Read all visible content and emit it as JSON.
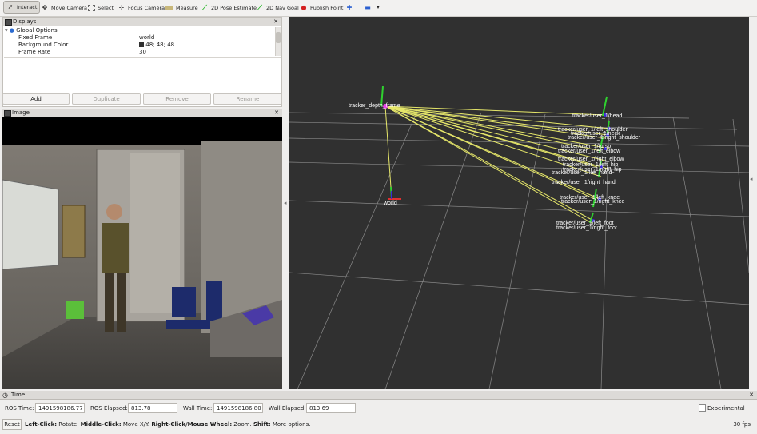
{
  "toolbar": {
    "tools": [
      {
        "label": "Interact",
        "icon": "cursor-icon"
      },
      {
        "label": "Move Camera",
        "icon": "move-icon"
      },
      {
        "label": "Select",
        "icon": "select-icon"
      },
      {
        "label": "Focus Camera",
        "icon": "focus-icon"
      },
      {
        "label": "Measure",
        "icon": "ruler-icon"
      },
      {
        "label": "2D Pose Estimate",
        "icon": "arrow-green-icon"
      },
      {
        "label": "2D Nav Goal",
        "icon": "arrow-green-icon"
      },
      {
        "label": "Publish Point",
        "icon": "pin-icon"
      }
    ]
  },
  "displays": {
    "title": "Displays",
    "global_options": "Global Options",
    "props": [
      {
        "name": "Fixed Frame",
        "value": "world"
      },
      {
        "name": "Background Color",
        "value": "48; 48; 48",
        "swatch": "#303030"
      },
      {
        "name": "Frame Rate",
        "value": "30"
      }
    ],
    "buttons": {
      "add": "Add",
      "duplicate": "Duplicate",
      "remove": "Remove",
      "rename": "Rename"
    }
  },
  "image_panel": {
    "title": "Image"
  },
  "scene": {
    "background": "#303030",
    "frames": {
      "origin": "tracker_depth_frame",
      "world": "world",
      "head": "tracker/user_1/head",
      "labels": [
        "tracker/user_1/left_shoulder",
        "tracker/user_1/neck",
        "tracker/user_1/right_shoulder",
        "tracker/user_1/torso",
        "tracker/user_1/left_elbow",
        "tracker/user_1/right_elbow",
        "tracker/user_1/left_hip",
        "tracker/user_1/right_hip",
        "tracker/user_1/left_hand",
        "tracker/user_1/right_hand",
        "tracker/user_1/left_knee",
        "tracker/user_1/right_knee",
        "tracker/user_1/left_foot",
        "tracker/user_1/right_foot"
      ]
    }
  },
  "time": {
    "title": "Time",
    "ros_time_label": "ROS Time:",
    "ros_time": "1491598186.77",
    "ros_elapsed_label": "ROS Elapsed:",
    "ros_elapsed": "813.78",
    "wall_time_label": "Wall Time:",
    "wall_time": "1491598186.80",
    "wall_elapsed_label": "Wall Elapsed:",
    "wall_elapsed": "813.69",
    "experimental": "Experimental"
  },
  "status": {
    "reset": "Reset",
    "left_click": "Left-Click:",
    "left_click_text": " Rotate. ",
    "middle_click": "Middle-Click:",
    "middle_click_text": " Move X/Y. ",
    "right_click": "Right-Click/Mouse Wheel:",
    "right_click_text": " Zoom. ",
    "shift": "Shift:",
    "shift_text": " More options.",
    "fps": "30 fps"
  }
}
